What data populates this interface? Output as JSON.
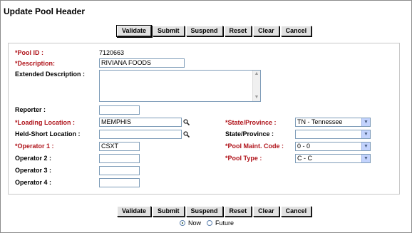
{
  "window": {
    "title": "Update Pool Header"
  },
  "toolbar": {
    "validate": "Validate",
    "submit": "Submit",
    "suspend": "Suspend",
    "reset": "Reset",
    "clear": "Clear",
    "cancel": "Cancel"
  },
  "form": {
    "pool_id_label": "*Pool ID :",
    "pool_id_value": "7120663",
    "description_label": "*Description:",
    "description_value": "RIVIANA FOODS",
    "extended_label": "Extended Description :",
    "reporter_label": "Reporter :",
    "loading_location_label": "*Loading Location :",
    "loading_location_value": "MEMPHIS",
    "held_short_label": "Held-Short Location :",
    "operator1_label": "*Operator 1 :",
    "operator1_value": "CSXT",
    "operator2_label": "Operator 2 :",
    "operator3_label": "Operator 3 :",
    "operator4_label": "Operator 4 :",
    "state1_label": "*State/Province :",
    "state1_value": "TN - Tennessee",
    "state2_label": "State/Province :",
    "state2_value": "",
    "pool_maint_label": "*Pool Maint. Code :",
    "pool_maint_value": "0 - 0",
    "pool_type_label": "*Pool Type :",
    "pool_type_value": "C - C"
  },
  "timing": {
    "now_label": "Now",
    "future_label": "Future",
    "selected": "Now"
  },
  "icons": {
    "lookup": "magnifier-icon",
    "dropdown": "chevron-down-icon"
  },
  "colors": {
    "required_label": "#b0141b",
    "field_border": "#7f9db9",
    "dropdown_button": "#c3d3fd"
  }
}
